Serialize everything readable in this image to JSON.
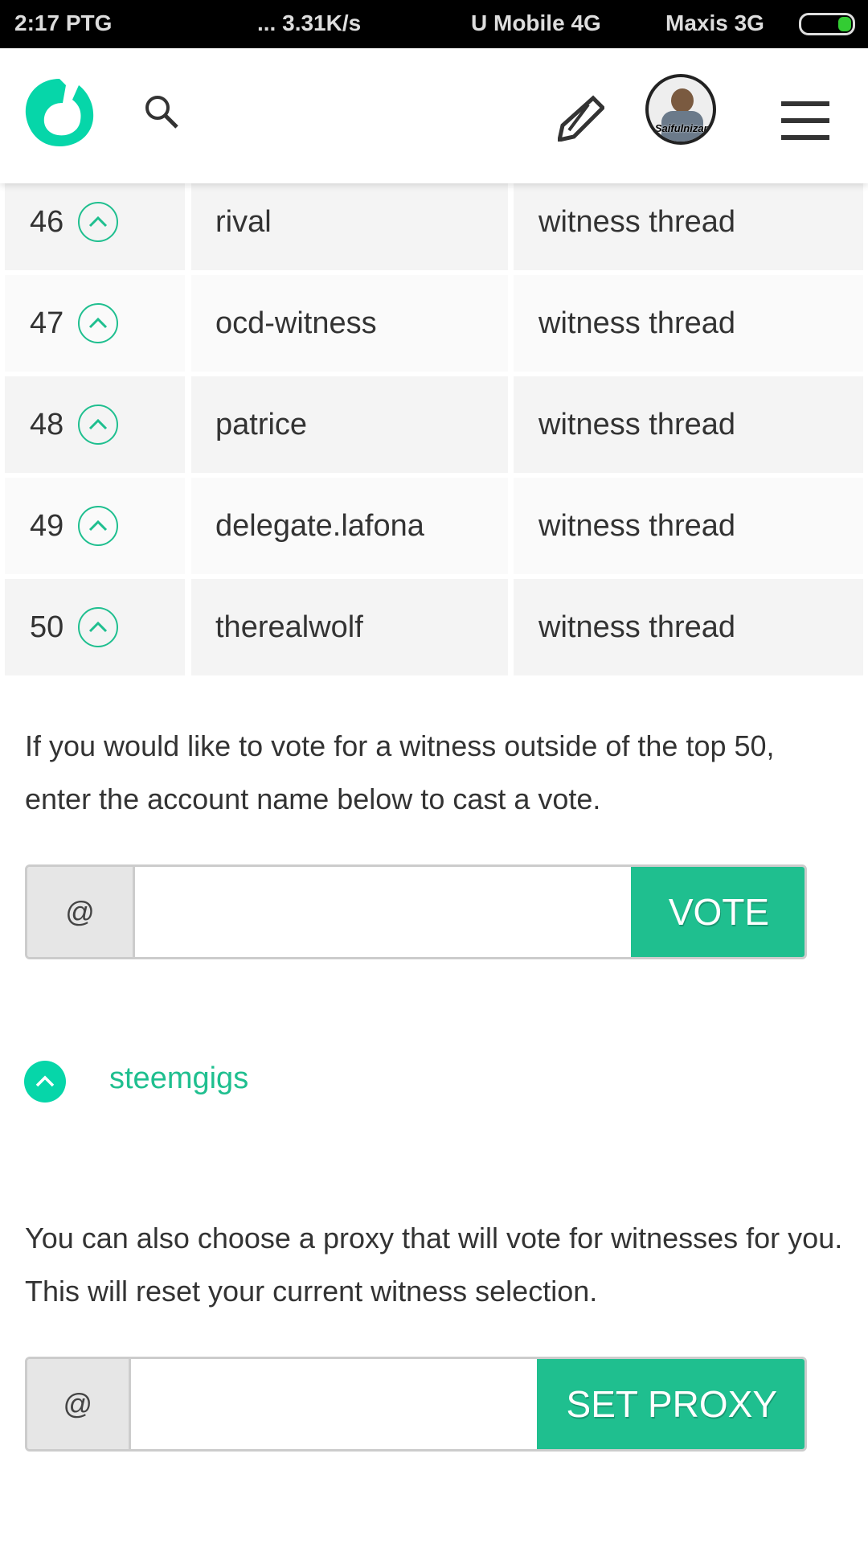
{
  "status_bar": {
    "time": "2:17 PTG",
    "speed": "... 3.31K/s",
    "carrier1": "U Mobile  4G",
    "carrier2": "Maxis 3G"
  },
  "header": {
    "logo": "steemit-logo",
    "search_icon": "search-icon",
    "post_icon": "pencil-icon",
    "avatar_label": "Saifulnizam",
    "menu_icon": "hamburger-icon"
  },
  "colors": {
    "accent": "#1fbf8f",
    "logo": "#06d6a9",
    "row_dark": "#f4f4f4",
    "row_light": "#fafafa"
  },
  "witnesses": [
    {
      "rank": "46",
      "name": "rival",
      "thread": "witness thread"
    },
    {
      "rank": "47",
      "name": "ocd-witness",
      "thread": "witness thread"
    },
    {
      "rank": "48",
      "name": "patrice",
      "thread": "witness thread"
    },
    {
      "rank": "49",
      "name": "delegate.lafona",
      "thread": "witness thread"
    },
    {
      "rank": "50",
      "name": "therealwolf",
      "thread": "witness thread"
    }
  ],
  "vote_section": {
    "text": "If you would like to vote for a witness outside of the top 50, enter the account name below to cast a vote.",
    "addon": "@",
    "value": "",
    "button": "VOTE"
  },
  "voted": {
    "name": "steemgigs"
  },
  "proxy_section": {
    "text": "You can also choose a proxy that will vote for witnesses for you. This will reset your current witness selection.",
    "addon": "@",
    "value": "",
    "button": "SET PROXY"
  }
}
